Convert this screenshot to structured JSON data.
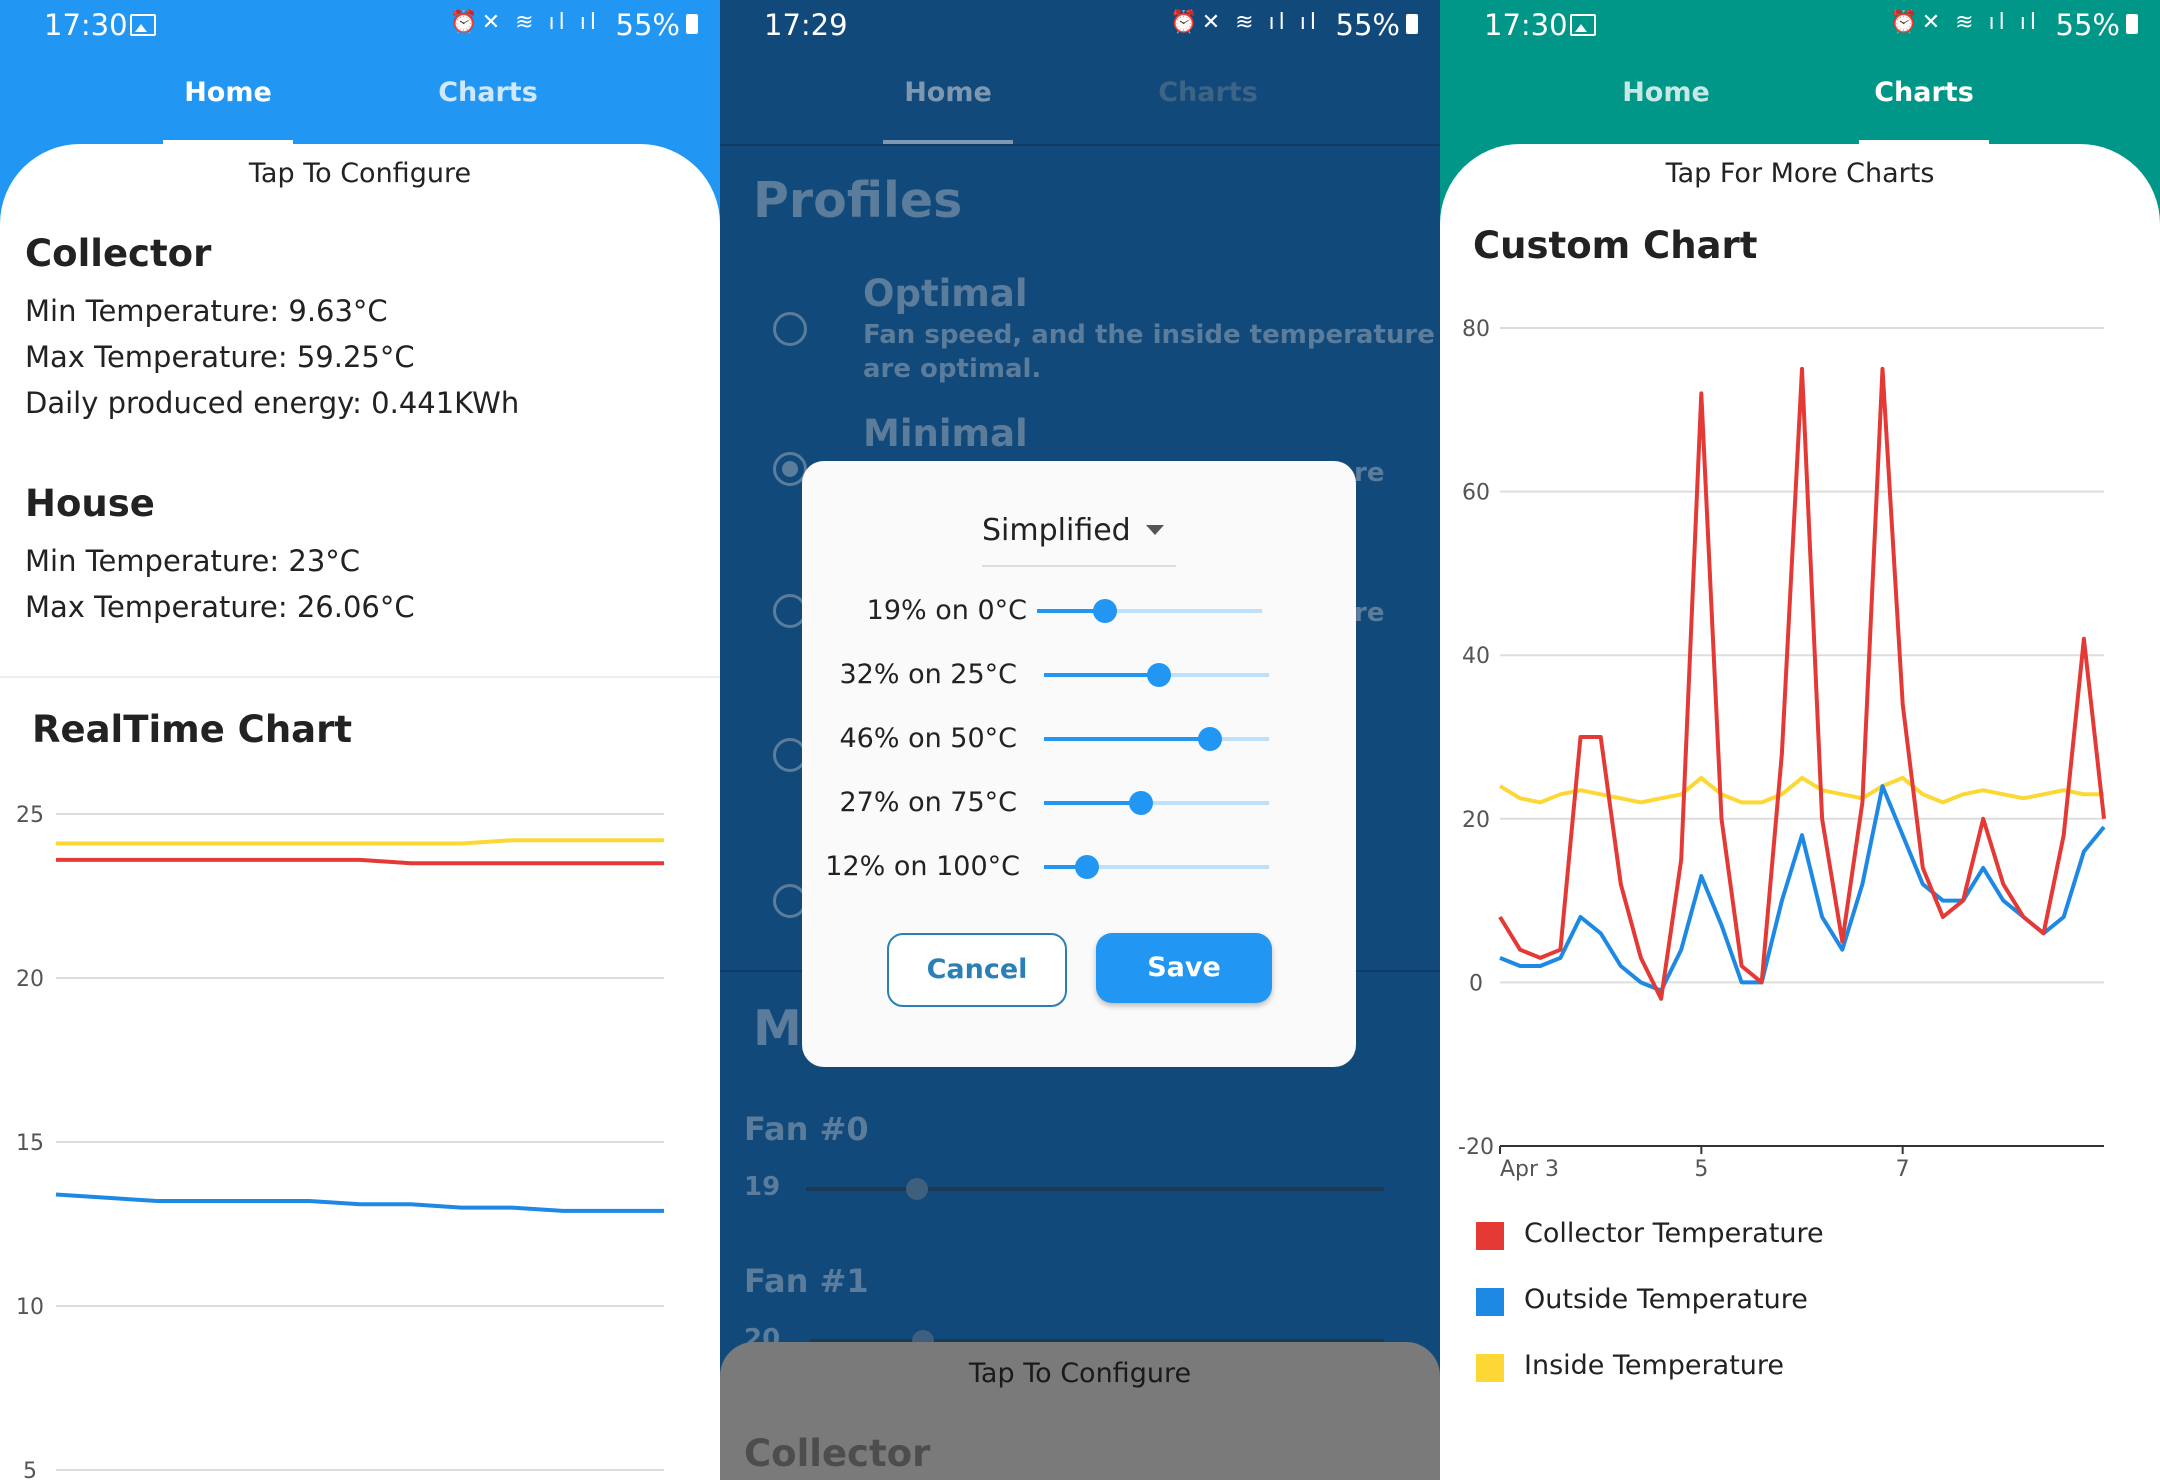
{
  "screens": [
    {
      "status": {
        "time": "17:30",
        "battery": "55%"
      },
      "tabs": [
        {
          "label": "Home",
          "active": true
        },
        {
          "label": "Charts",
          "active": false
        }
      ],
      "tap_label": "Tap To Configure",
      "collector": {
        "title": "Collector",
        "min": "Min Temperature: 9.63°C",
        "max": "Max Temperature: 59.25°C",
        "energy": "Daily produced energy: 0.441KWh"
      },
      "house": {
        "title": "House",
        "min": "Min Temperature: 23°C",
        "max": "Max Temperature: 26.06°C"
      },
      "chart_title": "RealTime Chart"
    },
    {
      "status": {
        "time": "17:29",
        "battery": "55%"
      },
      "tabs": [
        {
          "label": "Home",
          "active": true
        },
        {
          "label": "Charts",
          "active": false
        }
      ],
      "profiles_title": "Profiles",
      "profiles": [
        {
          "name": "Optimal",
          "desc_line1": "Fan speed, and the inside temperature",
          "desc_line2": "are optimal."
        },
        {
          "name": "Minimal",
          "partial": "re"
        },
        {
          "partial": "re"
        }
      ],
      "section_partial": "Ma",
      "fans": [
        {
          "label": "Fan #0",
          "value": "19"
        },
        {
          "label": "Fan #1",
          "value": "20"
        }
      ],
      "bottom_tap_label": "Tap To Configure",
      "bottom_title": "Collector",
      "dialog": {
        "mode": "Simplified",
        "rows": [
          {
            "label": "19% on 0°C",
            "value": 19
          },
          {
            "label": "32% on 25°C",
            "value": 32
          },
          {
            "label": "46% on 50°C",
            "value": 46
          },
          {
            "label": "27% on 75°C",
            "value": 27
          },
          {
            "label": "12% on 100°C",
            "value": 12
          }
        ],
        "cancel": "Cancel",
        "save": "Save"
      }
    },
    {
      "status": {
        "time": "17:30",
        "battery": "55%"
      },
      "tabs": [
        {
          "label": "Home",
          "active": false
        },
        {
          "label": "Charts",
          "active": true
        }
      ],
      "tap_label": "Tap For More Charts",
      "chart_title": "Custom Chart",
      "legend": [
        {
          "label": "Collector Temperature",
          "color": "#e53935"
        },
        {
          "label": "Outside Temperature",
          "color": "#1e88e5"
        },
        {
          "label": "Inside Temperature",
          "color": "#fdd835"
        }
      ]
    }
  ],
  "chart_data": [
    {
      "type": "line",
      "title": "RealTime Chart",
      "yticks": [
        25,
        20,
        15,
        10,
        5
      ],
      "ylim": [
        5,
        25
      ],
      "series": [
        {
          "color": "#fdd835",
          "values": [
            24.1,
            24.1,
            24.1,
            24.1,
            24.1,
            24.1,
            24.1,
            24.1,
            24.1,
            24.2,
            24.2,
            24.2,
            24.2
          ]
        },
        {
          "color": "#e53935",
          "values": [
            23.6,
            23.6,
            23.6,
            23.6,
            23.6,
            23.6,
            23.6,
            23.5,
            23.5,
            23.5,
            23.5,
            23.5,
            23.5
          ]
        },
        {
          "color": "#1e88e5",
          "values": [
            13.4,
            13.3,
            13.2,
            13.2,
            13.2,
            13.2,
            13.1,
            13.1,
            13.0,
            13.0,
            12.9,
            12.9,
            12.9
          ]
        }
      ]
    },
    {
      "type": "line",
      "title": "Custom Chart",
      "yticks": [
        80,
        60,
        40,
        20,
        0,
        -20
      ],
      "ylim": [
        -20,
        80
      ],
      "xticks": [
        {
          "label": "Apr 3",
          "day": 3
        },
        {
          "label": "5",
          "day": 5
        },
        {
          "label": "7",
          "day": 7
        }
      ],
      "x": [
        3.0,
        3.2,
        3.4,
        3.6,
        3.8,
        4.0,
        4.2,
        4.4,
        4.6,
        4.8,
        5.0,
        5.2,
        5.4,
        5.6,
        5.8,
        6.0,
        6.2,
        6.4,
        6.6,
        6.8,
        7.0,
        7.2,
        7.4,
        7.6,
        7.8,
        8.0,
        8.2,
        8.4,
        8.6,
        8.8,
        9.0
      ],
      "series": [
        {
          "name": "Collector Temperature",
          "color": "#e53935",
          "values": [
            8,
            4,
            3,
            4,
            30,
            30,
            12,
            3,
            -2,
            15,
            72,
            20,
            2,
            0,
            28,
            75,
            20,
            5,
            22,
            75,
            34,
            14,
            8,
            10,
            20,
            12,
            8,
            6,
            18,
            42,
            20
          ]
        },
        {
          "name": "Outside Temperature",
          "color": "#1e88e5",
          "values": [
            3,
            2,
            2,
            3,
            8,
            6,
            2,
            0,
            -1,
            4,
            13,
            7,
            0,
            0,
            10,
            18,
            8,
            4,
            12,
            24,
            18,
            12,
            10,
            10,
            14,
            10,
            8,
            6,
            8,
            16,
            19
          ]
        },
        {
          "name": "Inside Temperature",
          "color": "#fdd835",
          "values": [
            24,
            22.5,
            22,
            23,
            23.5,
            23,
            22.5,
            22,
            22.5,
            23,
            25,
            23,
            22,
            22,
            23,
            25,
            23.5,
            23,
            22.5,
            24,
            25,
            23,
            22,
            23,
            23.5,
            23,
            22.5,
            23,
            23.5,
            23,
            23
          ]
        }
      ]
    }
  ]
}
